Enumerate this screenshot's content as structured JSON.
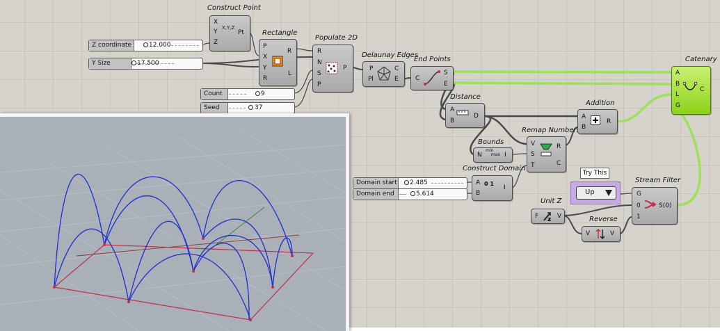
{
  "components": {
    "construct_point": {
      "title": "Construct Point",
      "inputs": [
        "X",
        "Y",
        "Z"
      ],
      "output": "Pt",
      "icon_text": "X,Y,Z"
    },
    "rectangle": {
      "title": "Rectangle",
      "inputs": [
        "P",
        "X",
        "Y",
        "R"
      ],
      "outputs": [
        "R",
        "L"
      ]
    },
    "populate_2d": {
      "title": "Populate 2D",
      "inputs": [
        "R",
        "N",
        "S",
        "P"
      ],
      "output": "P"
    },
    "delaunay_edges": {
      "title": "Delaunay Edges",
      "inputs": [
        "P",
        "Pl"
      ],
      "outputs": [
        "C",
        "E"
      ]
    },
    "end_points": {
      "title": "End Points",
      "input": "C",
      "outputs": [
        "S",
        "E"
      ]
    },
    "distance": {
      "title": "Distance",
      "inputs": [
        "A",
        "B"
      ],
      "output": "D"
    },
    "bounds": {
      "title": "Bounds",
      "input": "N",
      "output": "I",
      "icon_top": "min",
      "icon_bottom": "max"
    },
    "remap_numbers": {
      "title": "Remap Numbers",
      "inputs": [
        "V",
        "S",
        "T"
      ],
      "outputs": [
        "R",
        "C"
      ]
    },
    "addition": {
      "title": "Addition",
      "inputs": [
        "A",
        "B"
      ],
      "output": "R"
    },
    "construct_domain": {
      "title": "Construct Domain",
      "inputs": [
        "A",
        "B"
      ],
      "output": "I",
      "icon_text": "0 1"
    },
    "catenary": {
      "title": "Catenary",
      "inputs": [
        "A",
        "B",
        "L",
        "G"
      ],
      "output": "C"
    },
    "unit_z": {
      "title": "Unit Z",
      "input": "F",
      "output": "V"
    },
    "reverse": {
      "title": "Reverse",
      "input": "V",
      "output": "V"
    },
    "stream_filter": {
      "title": "Stream Filter",
      "inputs": [
        "G",
        "0",
        "1"
      ],
      "output": "S(0)"
    }
  },
  "sliders": [
    {
      "label": "Z coordinate",
      "value": "12.000"
    },
    {
      "label": "Y Size",
      "value": "17.500"
    },
    {
      "label": "Count",
      "value": "9"
    },
    {
      "label": "Seed",
      "value": "37"
    },
    {
      "label": "Domain start",
      "value": "2.485"
    },
    {
      "label": "Domain end",
      "value": "5.614"
    }
  ],
  "value_list": {
    "selected": "Up",
    "tooltip": "Try This"
  },
  "colors": {
    "canvas": "#d6d3cd",
    "component": "#b8b8b8",
    "catenary": "#9be02a",
    "wire_selected": "#9ee05a",
    "value_list": "#c9a8e6",
    "viewport": "#a9b0b8",
    "arch": "#1f2fd0",
    "rect": "#c0304a"
  }
}
